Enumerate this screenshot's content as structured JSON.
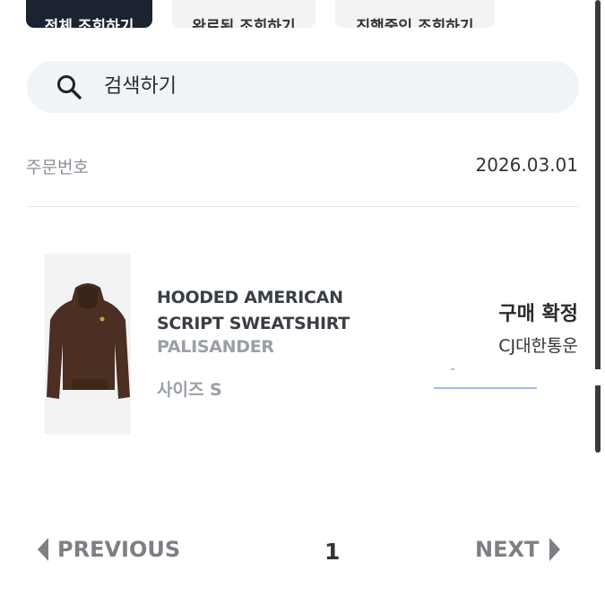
{
  "tabs": [
    {
      "label": "전체 조회하기"
    },
    {
      "label": "완료된 조회하기"
    },
    {
      "label": "진행중인 조회하기"
    }
  ],
  "search": {
    "placeholder": "검색하기",
    "icon": "search-icon"
  },
  "order": {
    "label": "주문번호",
    "date": "2026.03.01"
  },
  "product": {
    "name": "HOODED AMERICAN SCRIPT SWEATSHIRT",
    "color": "PALISANDER",
    "size": "사이즈 S",
    "image": "brown-hoodie-image"
  },
  "shipping": {
    "status": "구매 확정",
    "carrier": "CJ대한통운"
  },
  "pagination": {
    "prev_label": "PREVIOUS",
    "page": "1",
    "next_label": "NEXT"
  },
  "colors": {
    "active_tab": "#1c2330",
    "inactive_tab": "#f1f3f5",
    "search_bg": "#f1f4f6",
    "muted_text": "#9aa0a6"
  }
}
